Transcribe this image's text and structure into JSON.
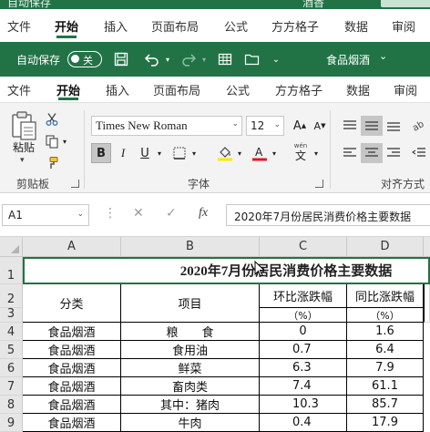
{
  "ghost_bar": {
    "left_text": "自动保存",
    "right_text": "酒香",
    "tabs": [
      "文件",
      "开始",
      "插入",
      "页面布局",
      "公式",
      "方方格子",
      "数据",
      "审阅"
    ]
  },
  "titlebar": {
    "autosave_label": "自动保存",
    "autosave_state": "关",
    "document_title": "食品烟酒",
    "accent_color": "#217346"
  },
  "ribbon_tabs": [
    "文件",
    "开始",
    "插入",
    "页面布局",
    "公式",
    "方方格子",
    "数据",
    "审阅"
  ],
  "ribbon": {
    "clipboard": {
      "paste_label": "粘贴",
      "group_label": "剪贴板"
    },
    "font": {
      "font_name": "Times New Roman",
      "font_size": "12",
      "bold": "B",
      "italic": "I",
      "group_label": "字体",
      "wen_label": "wén",
      "wen_char": "文"
    },
    "alignment": {
      "group_label": "对齐方式"
    }
  },
  "formula_bar": {
    "name_box": "A1",
    "cancel": "✕",
    "enter": "✓",
    "fx": "fx",
    "content": "2020年7月份居民消费价格主要数据"
  },
  "sheet": {
    "columns": [
      "A",
      "B",
      "C",
      "D"
    ],
    "rows": [
      "1",
      "2",
      "3",
      "4",
      "5",
      "6",
      "7",
      "8",
      "9"
    ],
    "title": "2020年7月份居民消费价格主要数据",
    "header": {
      "category": "分类",
      "item": "项目",
      "mom": "环比涨跌幅",
      "yoy": "同比涨跌幅",
      "unit_mom": "（%）",
      "unit_yoy": "（%）"
    },
    "data_rows": [
      {
        "category": "食品烟酒",
        "item": "粮　　食",
        "mom": "0",
        "yoy": "1.6"
      },
      {
        "category": "食品烟酒",
        "item": "食用油",
        "mom": "0.7",
        "yoy": "6.4"
      },
      {
        "category": "食品烟酒",
        "item": "鲜菜",
        "mom": "6.3",
        "yoy": "7.9"
      },
      {
        "category": "食品烟酒",
        "item": "畜肉类",
        "mom": "7.4",
        "yoy": "61.1"
      },
      {
        "category": "食品烟酒",
        "item": "其中：猪肉",
        "mom": "10.3",
        "yoy": "85.7"
      },
      {
        "category": "食品烟酒",
        "item": "牛肉",
        "mom": "0.4",
        "yoy": "17.9"
      }
    ]
  }
}
